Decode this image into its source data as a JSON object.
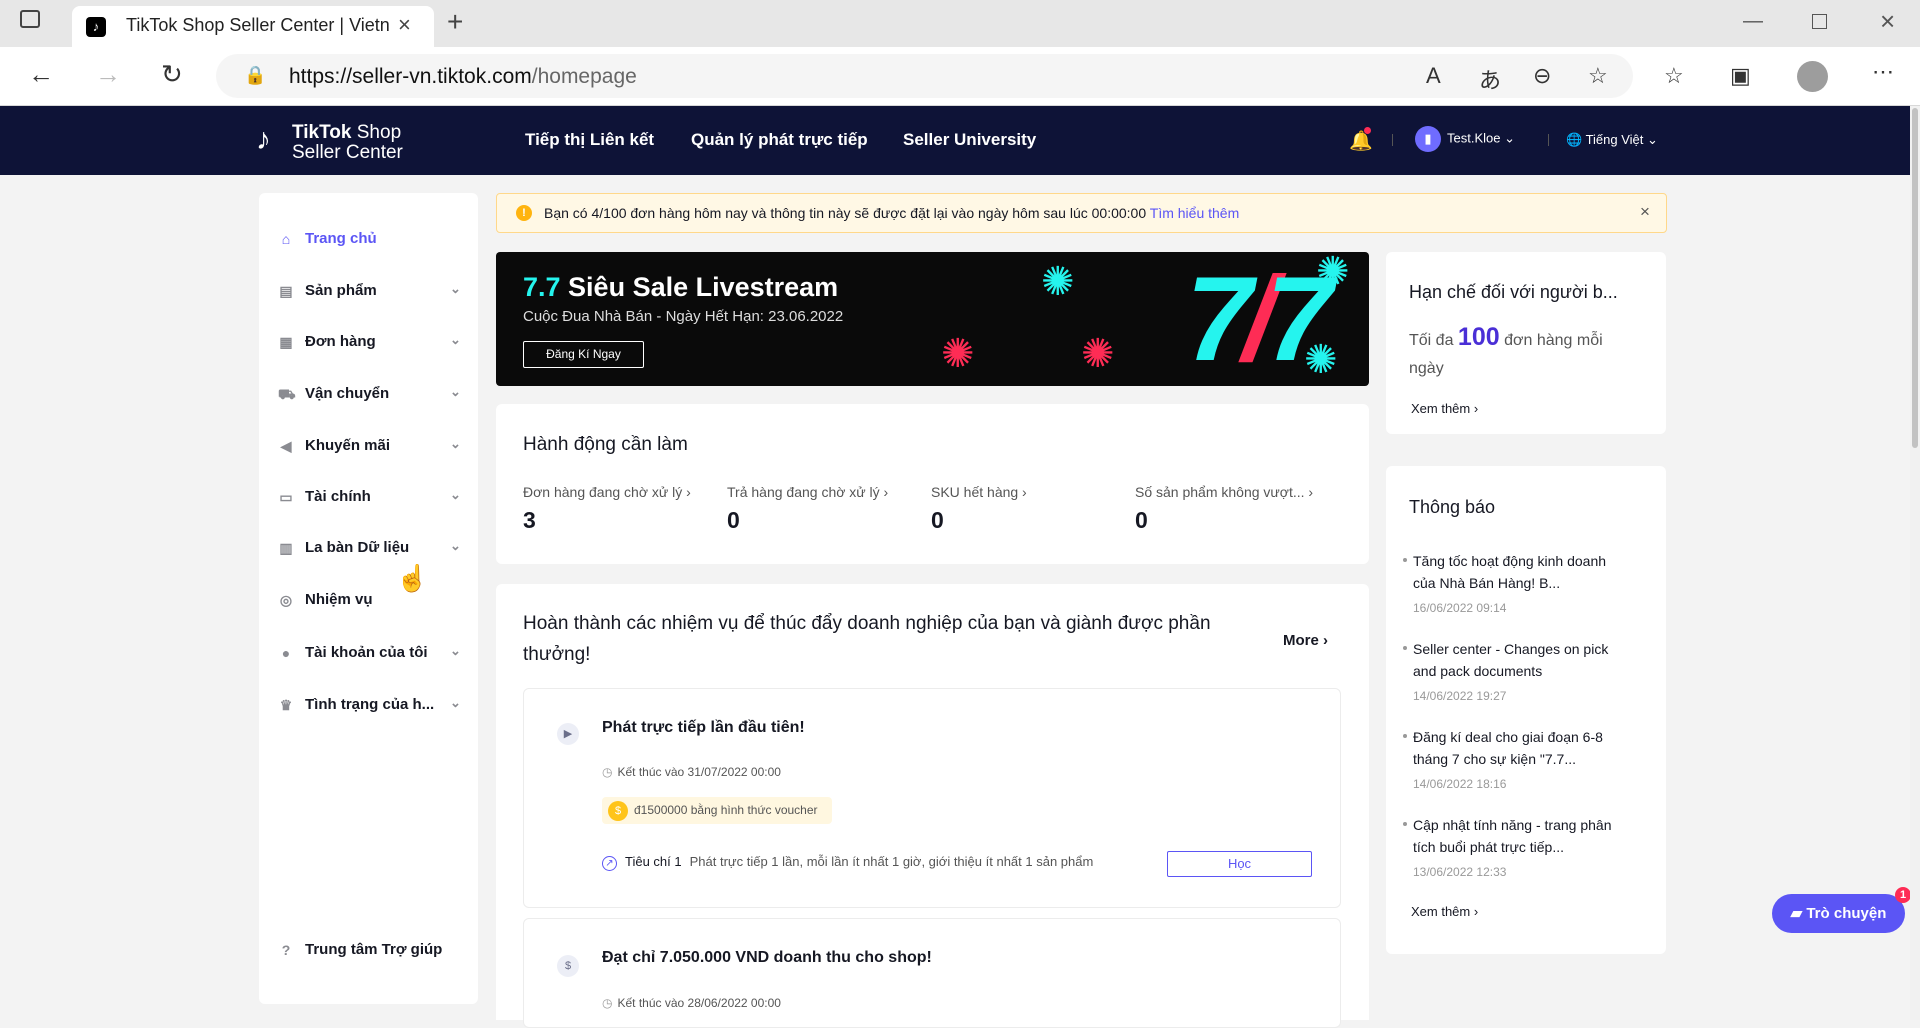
{
  "browser": {
    "tab_title": "TikTok Shop Seller Center | Vietn",
    "url_host": "https://seller-vn.tiktok.com",
    "url_path": "/homepage"
  },
  "header": {
    "logo_line1_bold": "TikTok",
    "logo_line1_rest": " Shop",
    "logo_line2": "Seller Center",
    "nav": [
      "Tiếp thị Liên kết",
      "Quản lý phát trực tiếp",
      "Seller University"
    ],
    "user": "Test.Kloe",
    "language": "Tiếng Việt"
  },
  "sidebar": {
    "items": [
      {
        "label": "Trang chủ",
        "icon": "home-icon"
      },
      {
        "label": "Sản phẩm",
        "icon": "product-icon"
      },
      {
        "label": "Đơn hàng",
        "icon": "order-icon"
      },
      {
        "label": "Vận chuyển",
        "icon": "truck-icon"
      },
      {
        "label": "Khuyến mãi",
        "icon": "megaphone-icon"
      },
      {
        "label": "Tài chính",
        "icon": "card-icon"
      },
      {
        "label": "La bàn Dữ liệu",
        "icon": "chart-icon"
      },
      {
        "label": "Nhiệm vụ",
        "icon": "medal-icon"
      },
      {
        "label": "Tài khoản của tôi",
        "icon": "user-icon"
      },
      {
        "label": "Tình trạng của h...",
        "icon": "trophy-icon"
      }
    ],
    "help": "Trung tâm Trợ giúp"
  },
  "notice": {
    "text": "Bạn có 4/100 đơn hàng hôm nay và thông tin này sẽ được đặt lại vào ngày hôm sau lúc 00:00:00",
    "link": "Tìm hiểu thêm"
  },
  "banner": {
    "title_accent": "7.7",
    "title_rest": " Siêu Sale Livestream",
    "subtitle": "Cuộc Đua Nhà Bán - Ngày Hết Hạn: 23.06.2022",
    "button": "Đăng Kí Ngay",
    "big_a": "7",
    "big_b": "/",
    "big_c": "7"
  },
  "actions": {
    "title": "Hành động cần làm",
    "stats": [
      {
        "label": "Đơn hàng đang chờ xử lý",
        "value": "3"
      },
      {
        "label": "Trả hàng đang chờ xử lý",
        "value": "0"
      },
      {
        "label": "SKU hết hàng",
        "value": "0"
      },
      {
        "label": "Số sản phẩm không vượt...",
        "value": "0"
      }
    ]
  },
  "tasks": {
    "title_line1": "Hoàn thành các nhiệm vụ để thúc đẩy doanh nghiệp của bạn và giành được phần",
    "title_line2": "thưởng!",
    "more": "More",
    "items": [
      {
        "title": "Phát trực tiếp lần đầu tiên!",
        "deadline": "Kết thúc vào 31/07/2022 00:00",
        "reward": "đ1500000 bằng hình thức voucher",
        "criteria_label": "Tiêu chí 1",
        "criteria": "Phát trực tiếp 1 lần, mỗi lần ít nhất 1 giờ, giới thiệu ít nhất 1 sản phẩm",
        "button": "Học"
      },
      {
        "title": "Đạt chỉ 7.050.000 VND doanh thu cho shop!",
        "deadline": "Kết thúc vào 28/06/2022 00:00"
      }
    ]
  },
  "limit": {
    "title": "Hạn chế đối với người b...",
    "text_pre": "Tối đa",
    "value": "100",
    "text_post1": "đơn hàng mỗi",
    "text_post2": "ngày",
    "link": "Xem thêm"
  },
  "announcements": {
    "title": "Thông báo",
    "items": [
      {
        "text": "Tăng tốc hoạt động kinh doanh của Nhà Bán Hàng! B...",
        "date": "16/06/2022 09:14"
      },
      {
        "text": "Seller center - Changes on pick and pack documents",
        "date": "14/06/2022 19:27"
      },
      {
        "text": "Đăng kí deal cho giai đoạn 6-8 tháng 7 cho sự kiện \"7.7...",
        "date": "14/06/2022 18:16"
      },
      {
        "text": "Cập nhật tính năng - trang phân tích buổi phát trực tiếp...",
        "date": "13/06/2022 12:33"
      }
    ],
    "link": "Xem thêm"
  },
  "chat": {
    "label": "Trò chuyện",
    "badge": "1"
  },
  "colors": {
    "header": "#0e1337",
    "accent": "#5b55f5",
    "tiktok_cyan": "#25f4ee",
    "tiktok_red": "#fe2c55"
  }
}
